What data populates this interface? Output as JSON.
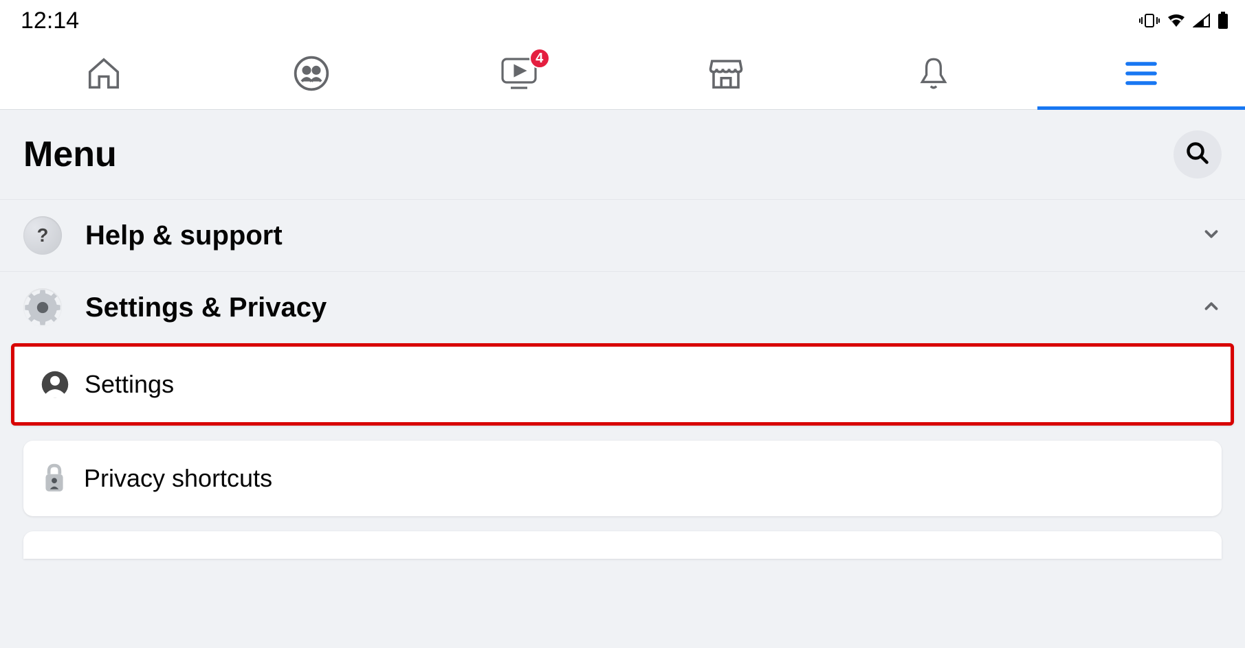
{
  "statusbar": {
    "time": "12:14"
  },
  "topnav": {
    "watch_badge": "4"
  },
  "menu": {
    "title": "Menu"
  },
  "sections": {
    "help": {
      "label": "Help & support",
      "expanded": false
    },
    "settings_privacy": {
      "label": "Settings & Privacy",
      "expanded": true
    }
  },
  "cards": {
    "settings": {
      "label": "Settings",
      "highlighted": true
    },
    "privacy_shortcuts": {
      "label": "Privacy shortcuts"
    }
  }
}
